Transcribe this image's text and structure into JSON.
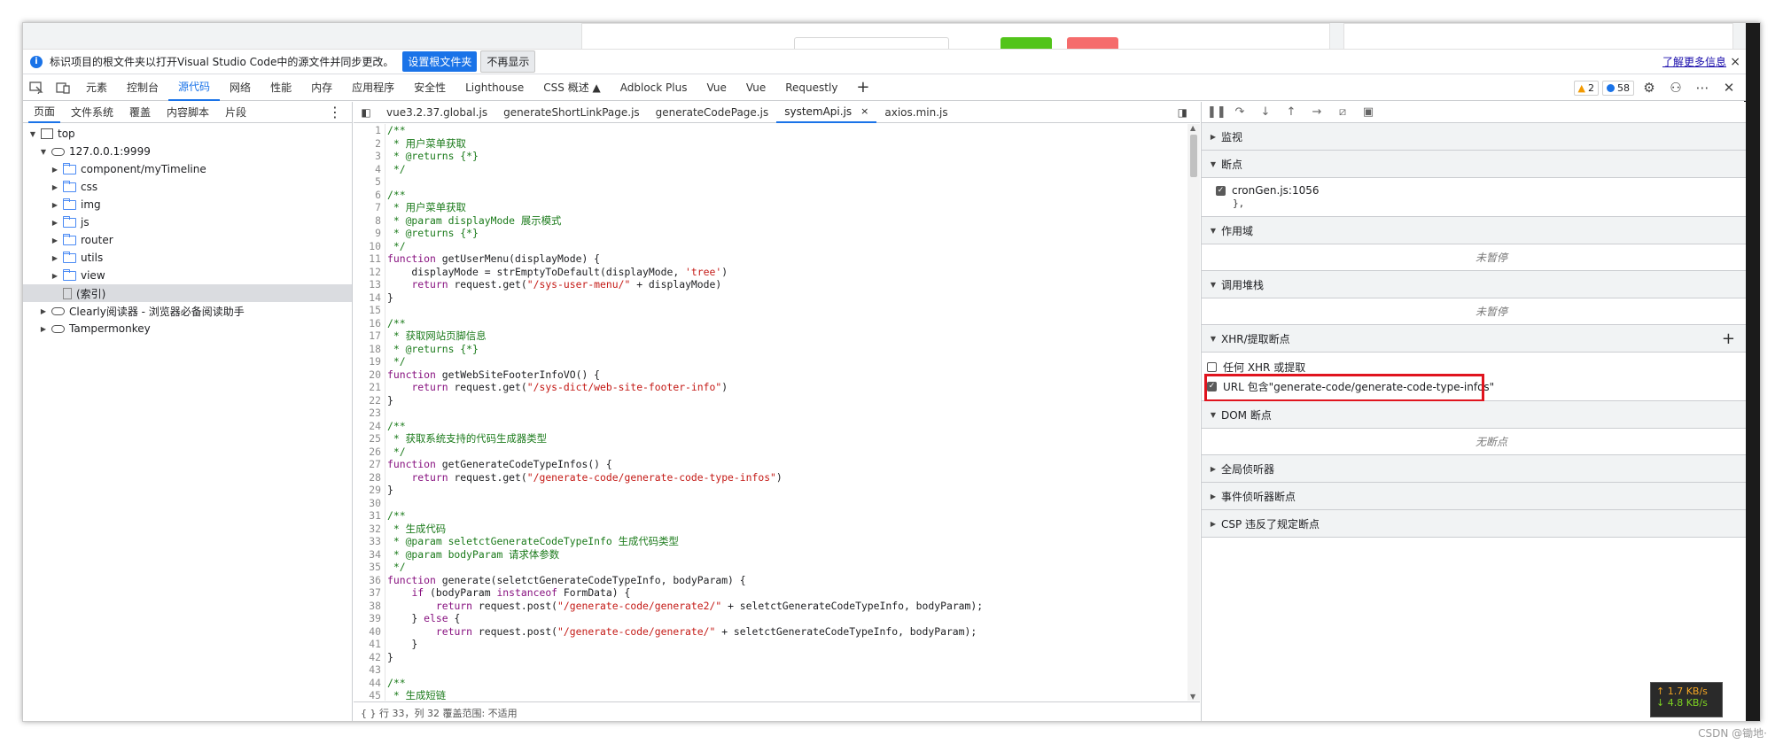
{
  "infobar": {
    "message": "标识项目的根文件夹以打开Visual Studio Code中的源文件并同步更改。",
    "set_root_button": "设置根文件夹",
    "dont_show_button": "不再显示",
    "learn_more": "了解更多信息",
    "close": "×"
  },
  "main_tabs": {
    "items": [
      "元素",
      "控制台",
      "源代码",
      "网络",
      "性能",
      "内存",
      "应用程序",
      "安全性",
      "Lighthouse",
      "CSS 概述 ▲",
      "Adblock Plus",
      "Vue",
      "Vue",
      "Requestly"
    ],
    "plus": "+",
    "warnings_count": "2",
    "messages_count": "58"
  },
  "navigator": {
    "tabs": [
      "页面",
      "文件系统",
      "覆盖",
      "内容脚本",
      "片段"
    ],
    "more": "⋮",
    "tree": {
      "top": "top",
      "host": "127.0.0.1:9999",
      "folders": [
        "component/myTimeline",
        "css",
        "img",
        "js",
        "router",
        "utils",
        "view"
      ],
      "index": "(索引)",
      "ext1": "Clearly阅读器 - 浏览器必备阅读助手",
      "ext2": "Tampermonkey"
    }
  },
  "editor": {
    "tabs": [
      "vue3.2.37.global.js",
      "generateShortLinkPage.js",
      "generateCodePage.js",
      "systemApi.js",
      "axios.min.js"
    ],
    "active_close": "×",
    "status": "{ }   行 33，列 32    覆盖范围: 不适用",
    "lines": [
      {
        "n": "1",
        "t": "/**",
        "k": "com"
      },
      {
        "n": "2",
        "t": " * 用户菜单获取",
        "k": "com"
      },
      {
        "n": "3",
        "t": " * @returns {*}",
        "k": "com"
      },
      {
        "n": "4",
        "t": " */",
        "k": "com"
      },
      {
        "n": "5",
        "t": "",
        "k": "def"
      },
      {
        "n": "6",
        "t": "/**",
        "k": "com"
      },
      {
        "n": "7",
        "t": " * 用户菜单获取",
        "k": "com"
      },
      {
        "n": "8",
        "t": " * @param displayMode 展示模式",
        "k": "com"
      },
      {
        "n": "9",
        "t": " * @returns {*}",
        "k": "com"
      },
      {
        "n": "10",
        "t": " */",
        "k": "com"
      },
      {
        "n": "11",
        "t": "function getUserMenu(displayMode) {",
        "k": "fn"
      },
      {
        "n": "12",
        "t": "    displayMode = strEmptyToDefault(displayMode, 'tree')",
        "k": "mix1"
      },
      {
        "n": "13",
        "t": "    return request.get(\"/sys-user-menu/\" + displayMode)",
        "k": "mix2"
      },
      {
        "n": "14",
        "t": "}",
        "k": "def"
      },
      {
        "n": "15",
        "t": "",
        "k": "def"
      },
      {
        "n": "16",
        "t": "/**",
        "k": "com"
      },
      {
        "n": "17",
        "t": " * 获取网站页脚信息",
        "k": "com"
      },
      {
        "n": "18",
        "t": " * @returns {*}",
        "k": "com"
      },
      {
        "n": "19",
        "t": " */",
        "k": "com"
      },
      {
        "n": "20",
        "t": "function getWebSiteFooterInfoVO() {",
        "k": "fn"
      },
      {
        "n": "21",
        "t": "    return request.get(\"/sys-dict/web-site-footer-info\")",
        "k": "mix2"
      },
      {
        "n": "22",
        "t": "}",
        "k": "def"
      },
      {
        "n": "23",
        "t": "",
        "k": "def"
      },
      {
        "n": "24",
        "t": "/**",
        "k": "com"
      },
      {
        "n": "25",
        "t": " * 获取系统支持的代码生成器类型",
        "k": "com"
      },
      {
        "n": "26",
        "t": " */",
        "k": "com"
      },
      {
        "n": "27",
        "t": "function getGenerateCodeTypeInfos() {",
        "k": "fn"
      },
      {
        "n": "28",
        "t": "    return request.get(\"/generate-code/generate-code-type-infos\")",
        "k": "mix2"
      },
      {
        "n": "29",
        "t": "}",
        "k": "def"
      },
      {
        "n": "30",
        "t": "",
        "k": "def"
      },
      {
        "n": "31",
        "t": "/**",
        "k": "com"
      },
      {
        "n": "32",
        "t": " * 生成代码",
        "k": "com"
      },
      {
        "n": "33",
        "t": " * @param seletctGenerateCodeTypeInfo 生成代码类型",
        "k": "com"
      },
      {
        "n": "34",
        "t": " * @param bodyParam 请求体参数",
        "k": "com"
      },
      {
        "n": "35",
        "t": " */",
        "k": "com"
      },
      {
        "n": "36",
        "t": "function generate(seletctGenerateCodeTypeInfo, bodyParam) {",
        "k": "fn"
      },
      {
        "n": "37",
        "t": "    if (bodyParam instanceof FormData) {",
        "k": "kwline"
      },
      {
        "n": "38",
        "t": "        return request.post(\"/generate-code/generate2/\" + seletctGenerateCodeTypeInfo, bodyParam);",
        "k": "mix2"
      },
      {
        "n": "39",
        "t": "    } else {",
        "k": "kwline"
      },
      {
        "n": "40",
        "t": "        return request.post(\"/generate-code/generate/\" + seletctGenerateCodeTypeInfo, bodyParam);",
        "k": "mix2"
      },
      {
        "n": "41",
        "t": "    }",
        "k": "def"
      },
      {
        "n": "42",
        "t": "}",
        "k": "def"
      },
      {
        "n": "43",
        "t": "",
        "k": "def"
      },
      {
        "n": "44",
        "t": "/**",
        "k": "com"
      },
      {
        "n": "45",
        "t": " * 生成短链",
        "k": "com"
      }
    ]
  },
  "debugger": {
    "watch": "监视",
    "breakpoints": "断点",
    "bp_file": "cronGen.js:1056",
    "bp_code": "},",
    "scope": "作用域",
    "not_paused": "未暂停",
    "call_stack": "调用堆栈",
    "not_paused2": "未暂停",
    "xhr": "XHR/提取断点",
    "xhr_any": "任何 XHR 或提取",
    "xhr_url": "URL 包含\"generate-code/generate-code-type-infos\"",
    "dom": "DOM 断点",
    "no_bp": "无断点",
    "global_listeners": "全局侦听器",
    "event_listeners": "事件侦听器断点",
    "csp": "CSP 违反了规定断点"
  },
  "speed": {
    "up": "↑ 1.7 KB/s",
    "down": "↓ 4.8 KB/s"
  },
  "watermark": "CSDN @锄地·"
}
